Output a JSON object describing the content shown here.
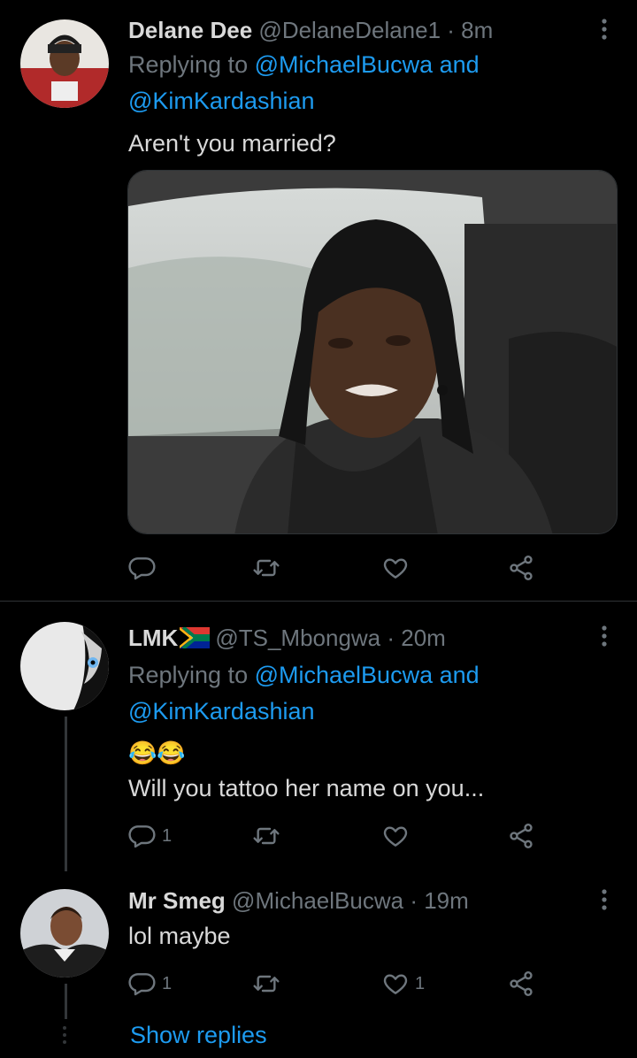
{
  "tweets": [
    {
      "display_name": "Delane Dee",
      "handle": "@DelaneDelane1",
      "time": "· 8m",
      "replying_prefix": "Replying to ",
      "mention_1": "@MichaelBucwa",
      "and_word": " and",
      "mention_2": "@KimKardashian",
      "text": "Aren't you married?",
      "has_media": true,
      "actions": {
        "reply_count": "",
        "retweet_count": "",
        "like_count": ""
      }
    },
    {
      "display_name": "LMK",
      "flag_icon": "south-africa-flag-icon",
      "handle": "@TS_Mbongwa",
      "time": "· 20m",
      "replying_prefix": "Replying to ",
      "mention_1": "@MichaelBucwa",
      "and_word": " and",
      "mention_2": "@KimKardashian",
      "emoji": "😂😂",
      "text": "Will you tattoo her name on you...",
      "actions": {
        "reply_count": "1",
        "retweet_count": "",
        "like_count": ""
      }
    },
    {
      "display_name": "Mr Smeg",
      "handle": "@MichaelBucwa",
      "time": "· 19m",
      "text": "lol maybe",
      "actions": {
        "reply_count": "1",
        "retweet_count": "",
        "like_count": "1"
      }
    }
  ],
  "show_replies": "Show replies",
  "colors": {
    "background": "#000000",
    "text": "#d9d9d9",
    "secondary": "#6e767d",
    "link": "#1d9bf0",
    "divider": "#2f3336"
  }
}
